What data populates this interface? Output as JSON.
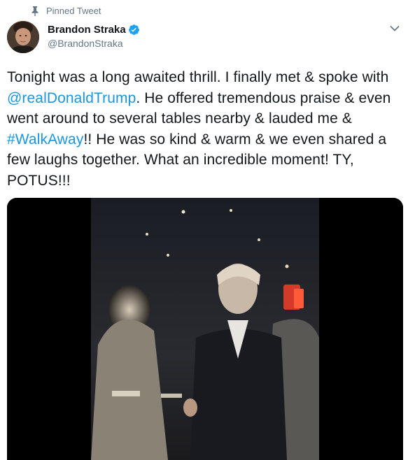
{
  "pinned": {
    "label": "Pinned Tweet"
  },
  "author": {
    "name": "Brandon Straka",
    "handle": "@BrandonStraka"
  },
  "tweet": {
    "segments": [
      {
        "text": "Tonight was a long awaited thrill. I finally met & spoke with ",
        "link": false
      },
      {
        "text": "@realDonaldTrump",
        "link": true
      },
      {
        "text": ". He offered tremendous praise & even went around to several tables nearby & lauded me & ",
        "link": false
      },
      {
        "text": "#WalkAway",
        "link": true
      },
      {
        "text": "!! He was so kind & warm & we even shared a few laughs together. What an incredible moment! TY, POTUS!!!",
        "link": false
      }
    ]
  },
  "colors": {
    "link": "#1b95e0",
    "verified": "#1da1f2",
    "secondary_text": "#657786"
  },
  "icons": {
    "pin": "pin-icon",
    "verified": "verified-badge-icon",
    "menu": "chevron-down-icon"
  }
}
